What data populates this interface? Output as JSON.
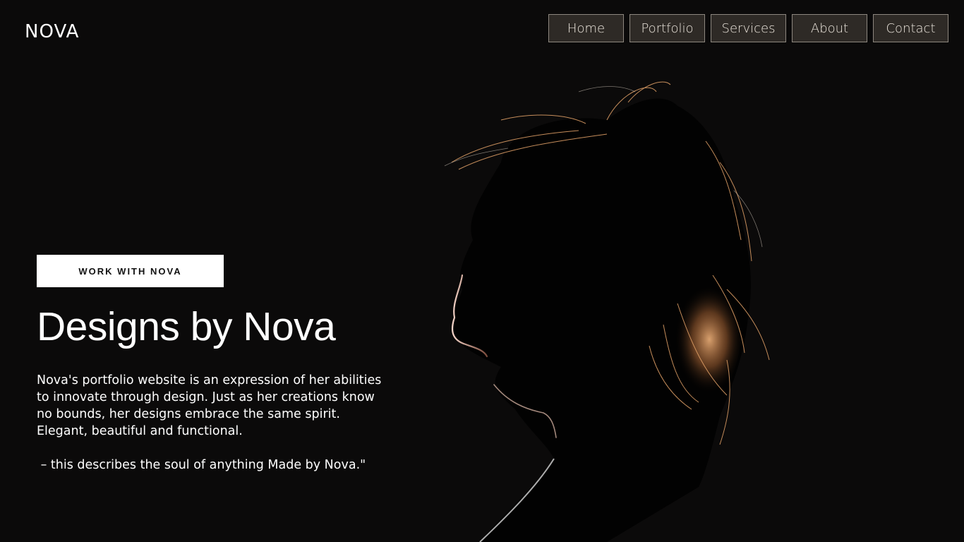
{
  "header": {
    "brand": "NOVA",
    "nav": [
      "Home",
      "Portfolio",
      "Services",
      "About",
      "Contact"
    ]
  },
  "hero": {
    "cta_label": "WORK WITH NOVA",
    "title": "Designs by Nova",
    "description": "Nova's portfolio website is an expression of her abilities to innovate through design. Just as her creations know no bounds, her designs embrace the same spirit. Elegant, beautiful and functional.",
    "quote": " – this describes the soul of anything Made by Nova.\""
  },
  "colors": {
    "background": "#0b0a0a",
    "nav_button_bg": "#2e2a26",
    "nav_button_border": "#8d877f",
    "hair_highlight": "#e7a56a"
  }
}
